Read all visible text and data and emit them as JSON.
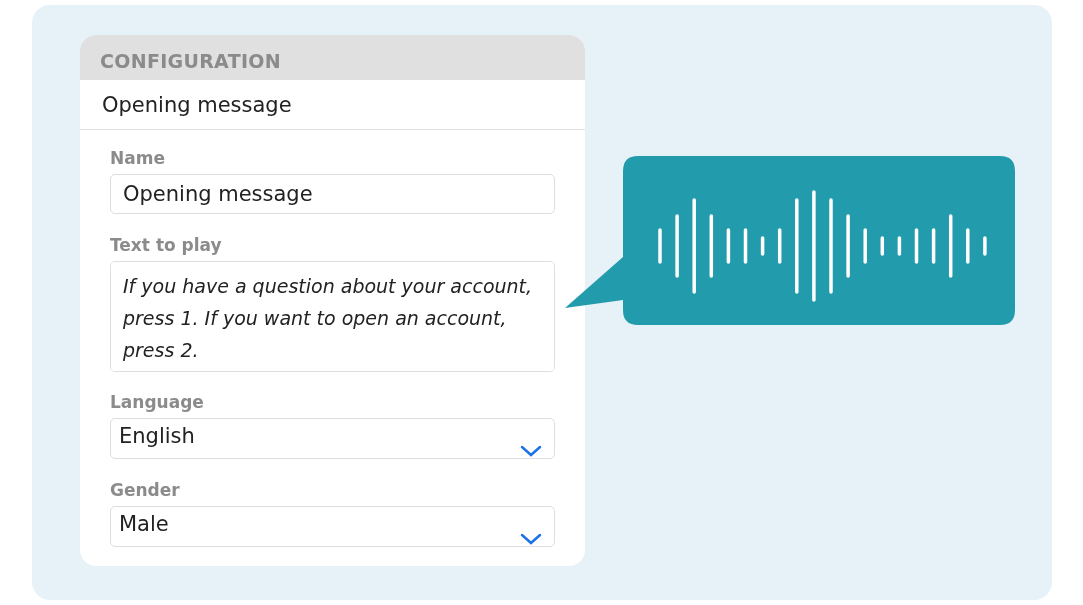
{
  "card": {
    "header": "CONFIGURATION",
    "title": "Opening message",
    "fields": [
      {
        "kind": "input",
        "label": "Name",
        "value": "Opening message"
      },
      {
        "kind": "textarea",
        "label": "Text to play",
        "value": "If you have a question about your account, press 1. If you want to open an account, press 2."
      },
      {
        "kind": "select",
        "label": "Language",
        "value": "English"
      },
      {
        "kind": "select",
        "label": "Gender",
        "value": "Male"
      }
    ]
  }
}
